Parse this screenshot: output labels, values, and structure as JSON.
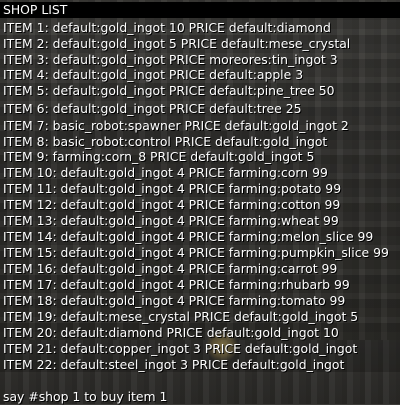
{
  "chat": {
    "title": "SHOP LIST",
    "items": [
      "ITEM 1: default:gold_ingot 10 PRICE default:diamond",
      "ITEM 2: default:gold_ingot 5 PRICE default:mese_crystal",
      "ITEM 3: default:gold_ingot PRICE moreores:tin_ingot 3",
      "ITEM 4: default:gold_ingot PRICE default:apple 3",
      "ITEM 5: default:gold_ingot PRICE default:pine_tree 50",
      "ITEM 6: default:gold_ingot PRICE default:tree 25",
      "ITEM 7: basic_robot:spawner PRICE default:gold_ingot 2",
      "ITEM 8: basic_robot:control PRICE default:gold_ingot",
      "ITEM 9: farming:corn_8 PRICE default:gold_ingot 5",
      "ITEM 10: default:gold_ingot 4 PRICE farming:corn 99",
      "ITEM 11: default:gold_ingot 4 PRICE farming:potato 99",
      "ITEM 12: default:gold_ingot 4 PRICE farming:cotton 99",
      "ITEM 13: default:gold_ingot 4 PRICE farming:wheat 99",
      "ITEM 14: default:gold_ingot 4 PRICE farming:melon_slice 99",
      "ITEM 15: default:gold_ingot 4 PRICE farming:pumpkin_slice 99",
      "ITEM 16: default:gold_ingot 4 PRICE farming:carrot 99",
      "ITEM 17: default:gold_ingot 4 PRICE farming:rhubarb 99",
      "ITEM 18: default:gold_ingot 4 PRICE farming:tomato 99",
      "ITEM 19: default:mese_crystal PRICE default:gold_ingot 5",
      "ITEM 20: default:diamond PRICE default:gold_ingot 10",
      "ITEM 21: default:copper_ingot 3 PRICE default:gold_ingot",
      "ITEM 22: default:steel_ingot 3 PRICE default:gold_ingot"
    ],
    "footer": "say #shop 1 to buy item 1"
  }
}
